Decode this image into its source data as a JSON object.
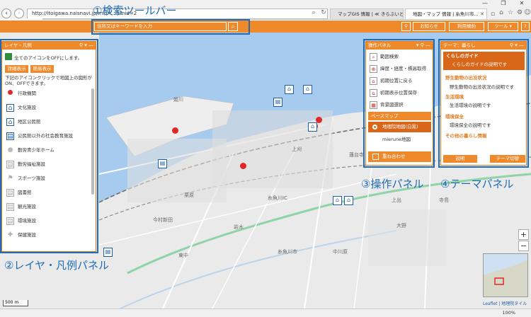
{
  "browser": {
    "address": "http://itoigawa.naisnavi.jp/mid=...&mid=2",
    "tabs": [
      {
        "label": "マップGIS 情報 | ≪ きらぶいといがわ",
        "active": false
      },
      {
        "label": "地図・マップ 情報 | 糸魚川市...",
        "active": true
      }
    ],
    "window_buttons": [
      "—",
      "❐",
      "✕"
    ],
    "zoom": "100%"
  },
  "toolbar": {
    "search_placeholder": "住所又はキーワードを入力",
    "buttons": [
      "お知らせ",
      "利用規約",
      "ツール",
      "?"
    ]
  },
  "layer_panel": {
    "title": "レイヤ・凡例",
    "all_off_label": "全てのアイコンをOFFにします。",
    "detail_button": "詳細表示",
    "simple_button": "簡易表示",
    "instructions": "下記のアイコンクリックで地図上の図形がON、OFFできます。",
    "items": [
      {
        "label": "行政機関",
        "icon": "red-dot-icon"
      },
      {
        "label": "文化施設",
        "icon": "museum-icon"
      },
      {
        "label": "地区公民館",
        "icon": "hall-icon"
      },
      {
        "label": "公民館以外の社会教育施設",
        "icon": "education-icon"
      },
      {
        "label": "勤労青少年ホーム",
        "icon": "youth-icon"
      },
      {
        "label": "勤労福祉施設",
        "icon": "welfare-icon"
      },
      {
        "label": "スポーツ施設",
        "icon": "sports-icon"
      },
      {
        "label": "図書館",
        "icon": "library-icon"
      },
      {
        "label": "観光施設",
        "icon": "tourism-icon"
      },
      {
        "label": "環境施設",
        "icon": "environment-icon"
      },
      {
        "label": "保健施設",
        "icon": "health-icon"
      }
    ]
  },
  "operation_panel": {
    "title": "操作パネル",
    "items": [
      "範囲検索",
      "緯度・経度・標高取得",
      "初期位置に戻る",
      "初期表示位置保存",
      "背景図選択"
    ],
    "basemap_header": "ベースマップ",
    "basemap_selected": "地理院地図(白黒)",
    "basemap_other": "mierune地図",
    "overlay_label": "重ね合わせ"
  },
  "theme_panel": {
    "title": "テーマ：暮らし",
    "active_theme": "くらしのガイド",
    "active_desc": "くらしのガイドの説明です",
    "themes": [
      {
        "name": "野生動物の出没状況",
        "desc": "野生動物の出没状況の説明です"
      },
      {
        "name": "生活環境",
        "desc": "生活環境の説明です"
      },
      {
        "name": "環境保全",
        "desc": "環境保全の説明です"
      },
      {
        "name": "その他の暮らし情報",
        "desc": ""
      }
    ],
    "explain_button": "説明",
    "switch_button": "テーマ切替"
  },
  "annotations": {
    "search_toolbar": "①検索ツールバー",
    "layer_panel": "②レイヤ・凡例パネル",
    "operation_panel": "③操作パネル",
    "theme_panel": "④テーマパネル"
  },
  "map": {
    "labels": [
      "糸魚川市",
      "糸魚川IC",
      "能生",
      "上刈",
      "蓮台寺",
      "押上",
      "梶屋敷",
      "寺町",
      "中川原",
      "今村新田",
      "須沢",
      "中浜",
      "上野",
      "栗原",
      "寺島",
      "上出",
      "大野",
      "東中",
      "中谷内",
      "姫川",
      "新田",
      "岩木",
      "竹ケ花",
      "田伏"
    ],
    "scale": "500 m",
    "attribution": "Leaflet | 地理院タイル"
  },
  "colors": {
    "accent": "#ee8a2c",
    "annotation": "#1f6cb5",
    "sea": "#a6cbee",
    "marker": "#e02828"
  }
}
